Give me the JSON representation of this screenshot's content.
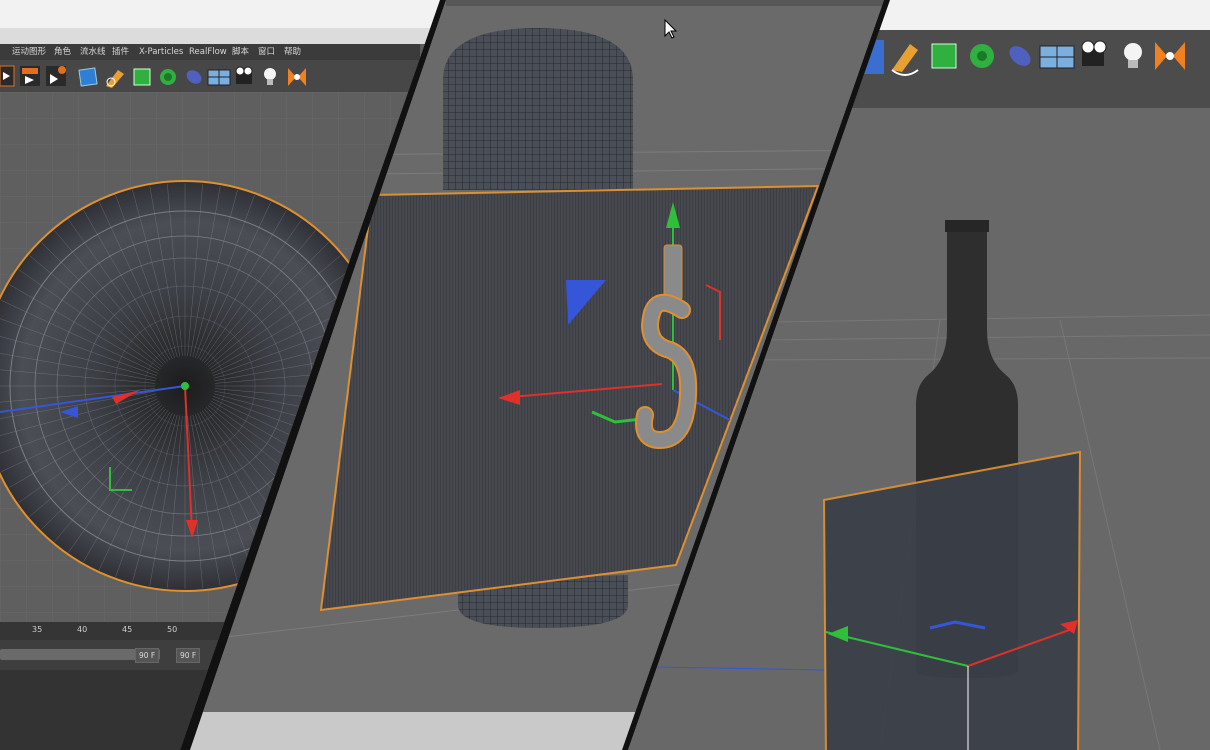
{
  "menu": {
    "items": [
      "运动图形",
      "角色",
      "流水线",
      "插件",
      "X-Particles",
      "RealFlow",
      "脚本",
      "窗口",
      "帮助"
    ]
  },
  "timeline": {
    "ticks": [
      "35",
      "40",
      "45",
      "50"
    ],
    "end_frame": "90 F",
    "end_frame_2": "90 F"
  },
  "colors": {
    "axis_x": "#e0302a",
    "axis_y": "#2fbf3a",
    "axis_z": "#3556d8",
    "selection": "#e08a2a",
    "viewport": "#5f5f5f",
    "ui_dark": "#3b3b3b"
  },
  "icons": [
    "cube-icon",
    "pen-icon",
    "subdivision-icon",
    "cloner-icon",
    "deformer-icon",
    "floor-icon",
    "camera-icon",
    "light-icon",
    "axis-center-icon"
  ]
}
